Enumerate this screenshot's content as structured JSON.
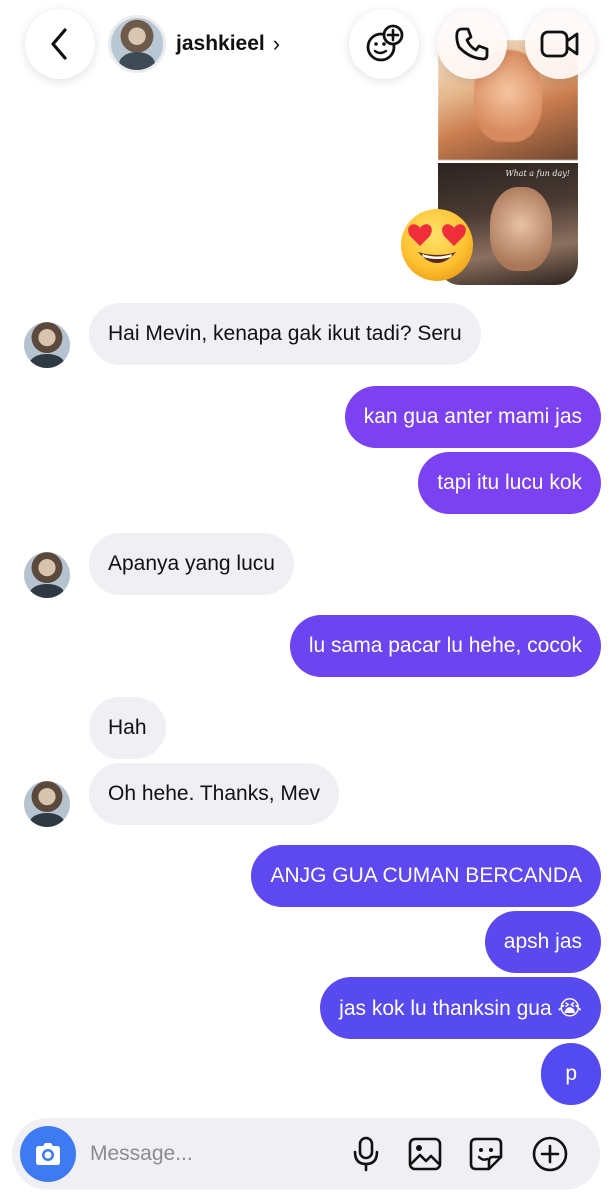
{
  "header": {
    "back_icon": "chevron-left-icon",
    "username": "jashkieel",
    "chevron": "›",
    "effects_icon": "effects-icon",
    "call_icon": "phone-icon",
    "video_icon": "video-camera-icon"
  },
  "shared_photo": {
    "caption": "What a fun day!",
    "reaction": "heart-eyes-emoji"
  },
  "messages": [
    {
      "side": "in",
      "text": "Hai Mevin, kenapa gak ikut tadi? Seru"
    },
    {
      "side": "out",
      "text": "kan gua anter mami jas"
    },
    {
      "side": "out",
      "text": "tapi itu lucu kok"
    },
    {
      "side": "in",
      "text": "Apanya yang lucu"
    },
    {
      "side": "out",
      "text": "lu sama pacar lu hehe, cocok"
    },
    {
      "side": "in",
      "text": "Hah"
    },
    {
      "side": "in",
      "text": "Oh hehe. Thanks, Mev"
    },
    {
      "side": "out",
      "text": "ANJG GUA CUMAN BERCANDA"
    },
    {
      "side": "out",
      "text": "apsh jas"
    },
    {
      "side": "out",
      "text": "jas kok lu thanksin gua 😭"
    },
    {
      "side": "out",
      "text": "p"
    }
  ],
  "composer": {
    "placeholder": "Message...",
    "icons": [
      "camera-icon",
      "microphone-icon",
      "gallery-icon",
      "sticker-icon",
      "plus-icon"
    ]
  },
  "colors": {
    "outgoing_top": "#8a3ff0",
    "outgoing_bottom": "#4b52ef",
    "incoming": "#efeff4",
    "camera_button": "#3e7bf3"
  }
}
